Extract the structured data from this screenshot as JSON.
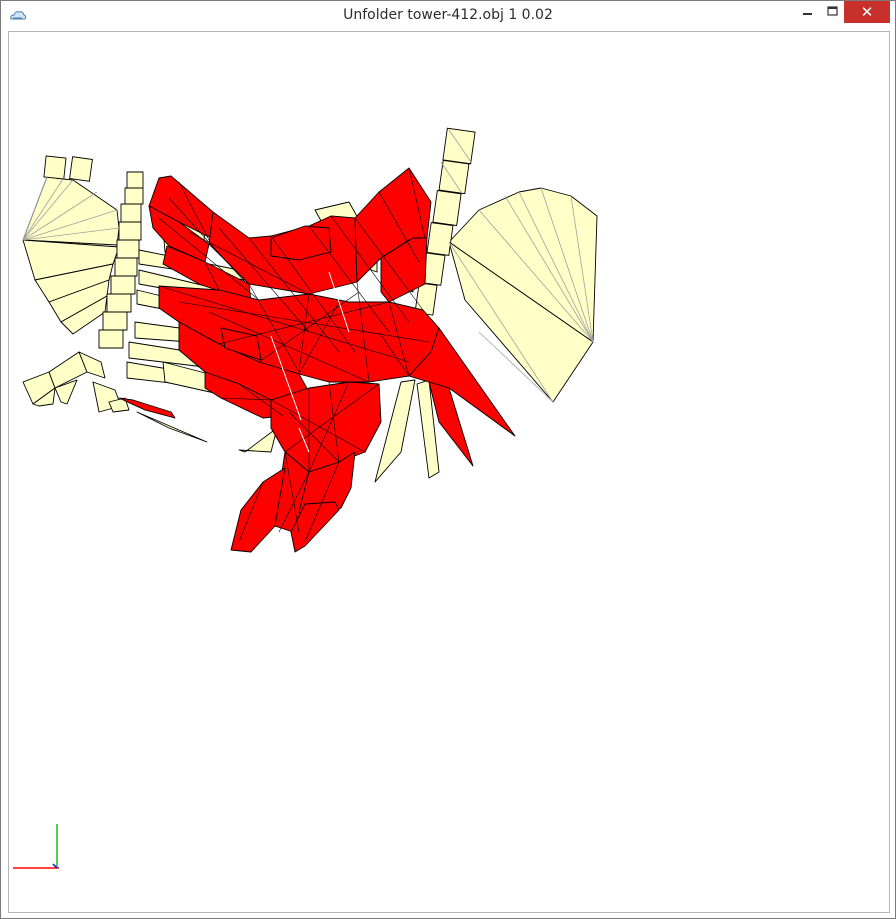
{
  "window": {
    "title": "Unfolder tower-412.obj 1 0.02",
    "close_glyph": "✕"
  },
  "icons": {
    "app": "app-cloud-icon",
    "minimize": "minimize-icon",
    "maximize": "maximize-icon",
    "close": "close-icon"
  },
  "colors": {
    "face_ok": "#ffffc8",
    "face_overlap": "#ff0000",
    "edge": "#000000",
    "fold_line": "#a0a0a0",
    "axis_x": "#ff0000",
    "axis_y": "#00c000",
    "close_button": "#c7302b"
  }
}
